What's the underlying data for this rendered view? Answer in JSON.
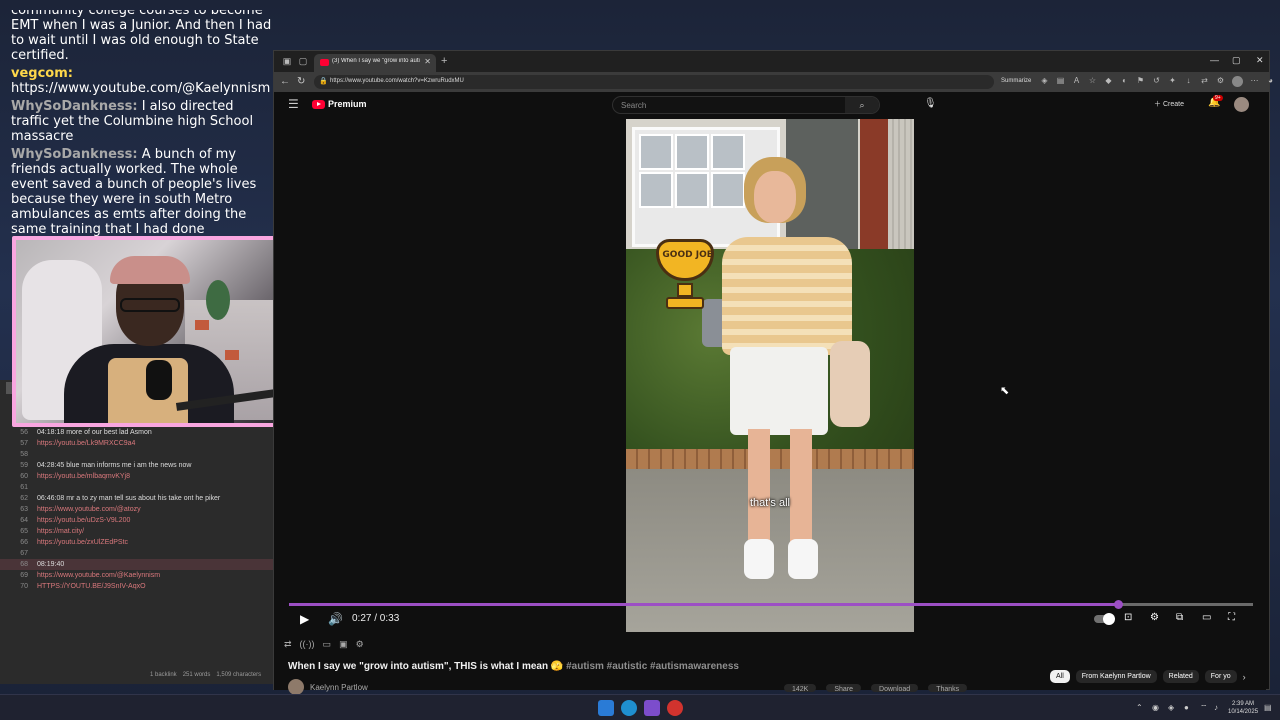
{
  "chat": {
    "partial_line": "community college courses to become an",
    "messages": [
      {
        "user": "",
        "text": "EMT when I was a Junior. And then I had to wait until I was old enough to State certified."
      },
      {
        "user": "vegcom:",
        "text": "https://www.youtube.com/@Kaelynnism",
        "style": "vegcom"
      },
      {
        "user": "WhySoDankness:",
        "text": "I also directed traffic yet the Columbine high School massacre",
        "style": "why"
      },
      {
        "user": "WhySoDankness:",
        "text": "A bunch of my friends actually worked. The whole event saved a bunch of people's lives because they were in south Metro ambulances as emts after doing the same training that I had done",
        "style": "why"
      }
    ]
  },
  "notes": {
    "lines": [
      {
        "n": "56",
        "text": "04:18:18 more of our best lad Asmon",
        "kind": "txt"
      },
      {
        "n": "57",
        "text": "https://youtu.be/Lk9MRXCC9a4",
        "kind": "link"
      },
      {
        "n": "58",
        "text": "",
        "kind": "txt"
      },
      {
        "n": "59",
        "text": "04:28:45  blue man informs me i am the news now",
        "kind": "txt"
      },
      {
        "n": "60",
        "text": "https://youtu.be/mlbaqmvKYj8",
        "kind": "link"
      },
      {
        "n": "61",
        "text": "",
        "kind": "txt"
      },
      {
        "n": "62",
        "text": "06:46:08  mr a to zy man tell sus about his take ont he piker",
        "kind": "txt"
      },
      {
        "n": "63",
        "text": "https://www.youtube.com/@atozy",
        "kind": "link"
      },
      {
        "n": "64",
        "text": "https://youtu.be/uDzS-V9L200",
        "kind": "link"
      },
      {
        "n": "65",
        "text": "https://mat.city/",
        "kind": "link"
      },
      {
        "n": "66",
        "text": "https://youtu.be/zxUlZEdPStc",
        "kind": "link"
      },
      {
        "n": "67",
        "text": "",
        "kind": "txt"
      },
      {
        "n": "68",
        "text": "08:19:40",
        "kind": "txt",
        "highlight": true
      },
      {
        "n": "69",
        "text": "https://www.youtube.com/@Kaelynnism",
        "kind": "link"
      },
      {
        "n": "70",
        "text": "HTTPS://YOUTU.BE/J9SnIV-AqxO",
        "kind": "link"
      }
    ],
    "status": {
      "backlinks": "1 backlink",
      "words": "251 words",
      "chars": "1,509 characters"
    }
  },
  "browser": {
    "tab_title": "(3) When I say we \"grow into auti",
    "url": "https://www.youtube.com/watch?v=KzwruRudxMU",
    "summarize_label": "Summarize"
  },
  "youtube": {
    "brand": "Premium",
    "search_placeholder": "Search",
    "create_label": "Create",
    "notification_count": "9+",
    "caption": "that's all",
    "sticker_text": "GOOD JOB",
    "time_display": "0:27 / 0:33",
    "progress": 0.86,
    "title": "When I say we \"grow into autism\", THIS is what I mean",
    "title_emoji": "🫣",
    "hashtags": "#autism #autistic #autismawareness",
    "channel_name": "Kaelynn Partlow",
    "chips": [
      "All",
      "From Kaelynn Partlow",
      "Related",
      "For yo"
    ],
    "actions": [
      "142K",
      "Share",
      "Download",
      "Thanks"
    ]
  },
  "taskbar": {
    "time": "2:39 AM",
    "date": "10/14/2025"
  },
  "colors": {
    "progress": "#9c4fc4",
    "webcam_border": "#f9a6e0",
    "yt_red": "#ff0033",
    "vegcom": "#ffd84a"
  }
}
